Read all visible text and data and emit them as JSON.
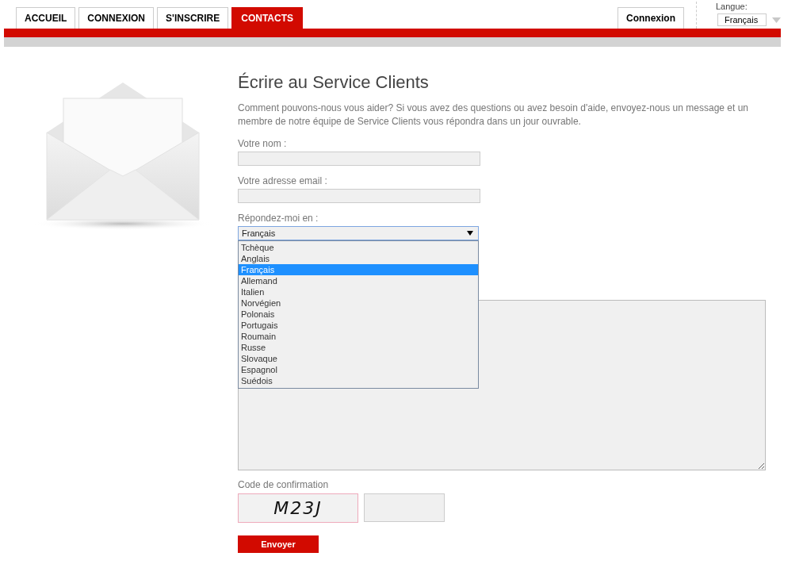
{
  "nav": {
    "tabs": [
      {
        "label": "ACCUEIL",
        "selected": false
      },
      {
        "label": "CONNEXION",
        "selected": false
      },
      {
        "label": "S'INSCRIRE",
        "selected": false
      },
      {
        "label": "CONTACTS",
        "selected": true
      }
    ],
    "login_button": "Connexion",
    "language": {
      "label": "Langue:",
      "value": "Français"
    }
  },
  "form": {
    "title": "Écrire au Service Clients",
    "intro": "Comment pouvons-nous vous aider? Si vous avez des questions ou avez besoin d'aide, envoyez-nous un message et un membre de notre équipe de Service Clients vous répondra dans un jour ouvrable.",
    "fields": [
      {
        "label": "Votre nom :"
      },
      {
        "label": "Votre adresse email :"
      }
    ],
    "reply_language": {
      "label": "Répondez-moi en :",
      "value": "Français",
      "expanded": true,
      "options": [
        {
          "label": "Tchèque",
          "selected": false
        },
        {
          "label": "Anglais",
          "selected": false
        },
        {
          "label": "Français",
          "selected": true
        },
        {
          "label": "Allemand",
          "selected": false
        },
        {
          "label": "Italien",
          "selected": false
        },
        {
          "label": "Norvégien",
          "selected": false
        },
        {
          "label": "Polonais",
          "selected": false
        },
        {
          "label": "Portugais",
          "selected": false
        },
        {
          "label": "Roumain",
          "selected": false
        },
        {
          "label": "Russe",
          "selected": false
        },
        {
          "label": "Slovaque",
          "selected": false
        },
        {
          "label": "Espagnol",
          "selected": false
        },
        {
          "label": "Suédois",
          "selected": false
        }
      ]
    },
    "captcha": {
      "label": "Code de confirmation",
      "code": "M23J"
    },
    "submit": "Envoyer"
  }
}
